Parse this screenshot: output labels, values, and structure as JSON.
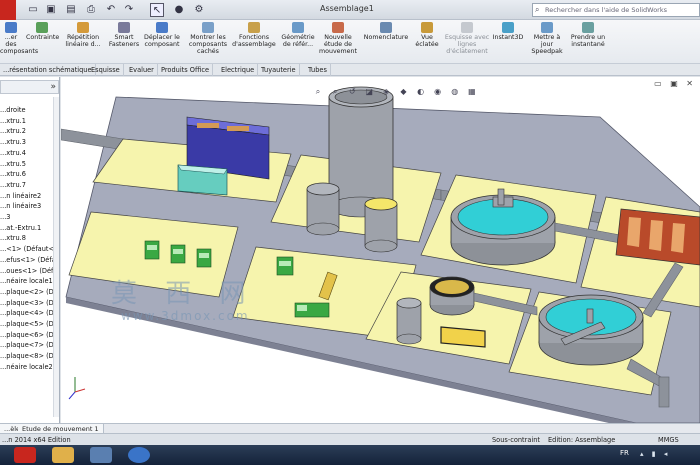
{
  "window": {
    "title": "Assemblage1",
    "help_placeholder": "Rechercher dans l'aide de SolidWorks"
  },
  "ribbon": {
    "buttons": [
      {
        "label": "...er des composants",
        "icon": "insert-components-icon",
        "enabled": true
      },
      {
        "label": "Contrainte",
        "icon": "mate-icon",
        "enabled": true
      },
      {
        "label": "Répétition linéaire d...",
        "icon": "linear-pattern-icon",
        "enabled": true
      },
      {
        "label": "Smart Fasteners",
        "icon": "smart-fasteners-icon",
        "enabled": true
      },
      {
        "label": "Déplacer le composant",
        "icon": "move-component-icon",
        "enabled": true
      },
      {
        "label": "Montrer les composants cachés",
        "icon": "show-hidden-icon",
        "enabled": true
      },
      {
        "label": "Fonctions d'assemblage",
        "icon": "assembly-features-icon",
        "enabled": true
      },
      {
        "label": "Géométrie de référ...",
        "icon": "reference-geometry-icon",
        "enabled": true
      },
      {
        "label": "Nouvelle étude de mouvement",
        "icon": "motion-study-icon",
        "enabled": true
      },
      {
        "label": "Nomenclature",
        "icon": "bom-icon",
        "enabled": true
      },
      {
        "label": "Vue éclatée",
        "icon": "exploded-view-icon",
        "enabled": true
      },
      {
        "label": "Esquisse avec lignes d'éclatement",
        "icon": "explode-line-sketch-icon",
        "enabled": false
      },
      {
        "label": "Instant3D",
        "icon": "instant3d-icon",
        "enabled": true
      },
      {
        "label": "Mettre à jour Speedpak",
        "icon": "speedpak-icon",
        "enabled": true
      },
      {
        "label": "Prendre un instantané",
        "icon": "snapshot-icon",
        "enabled": true
      }
    ]
  },
  "tabs": [
    "...résentation schématique",
    "Esquisse",
    "Evaluer",
    "Produits Office",
    "Electrique",
    "Tuyauterie",
    "Tubes"
  ],
  "feature_tree": {
    "items": [
      "...droite",
      "...xtru.1",
      "...xtru.2",
      "...xtru.3",
      "...xtru.4",
      "...xtru.5",
      "...xtru.6",
      "...xtru.7",
      "...n linéaire2",
      "...n linéaire3",
      "...3",
      "...at.-Extru.1",
      "...xtru.8",
      "...<1> (Défaut<<",
      "...efus<1> (Défaut",
      "...oues<1> (Défau",
      "...néaire locale1",
      "...plaque<2> (Déf",
      "...plaque<3> (Déf",
      "...plaque<4> (Déf",
      "...plaque<5> (Déf",
      "...plaque<6> (Déf",
      "...plaque<7> (Déf",
      "...plaque<8> (Déf",
      "...néaire locale2"
    ]
  },
  "watermark": {
    "chars": "莫 西 网",
    "url": "www.3dmox.com"
  },
  "bottom_tabs": [
    "...èle",
    "Etude de mouvement 1"
  ],
  "status": {
    "edition": "...n 2014 x64 Edition",
    "constraint": "Sous-contraint",
    "mode": "Edition: Assemblage",
    "units": "MMGS"
  },
  "taskbar": {
    "lang": "FR"
  },
  "colors": {
    "slab": "#f7f5ae",
    "base": "#a3a8ba",
    "pipe": "#8a8f98",
    "tank": "#9a9ea6",
    "water": "#32d0d6",
    "truck": "#39a742",
    "blue_block": "#3d3da8",
    "cyan_block": "#6bd3c5",
    "rust": "#b8482a"
  }
}
